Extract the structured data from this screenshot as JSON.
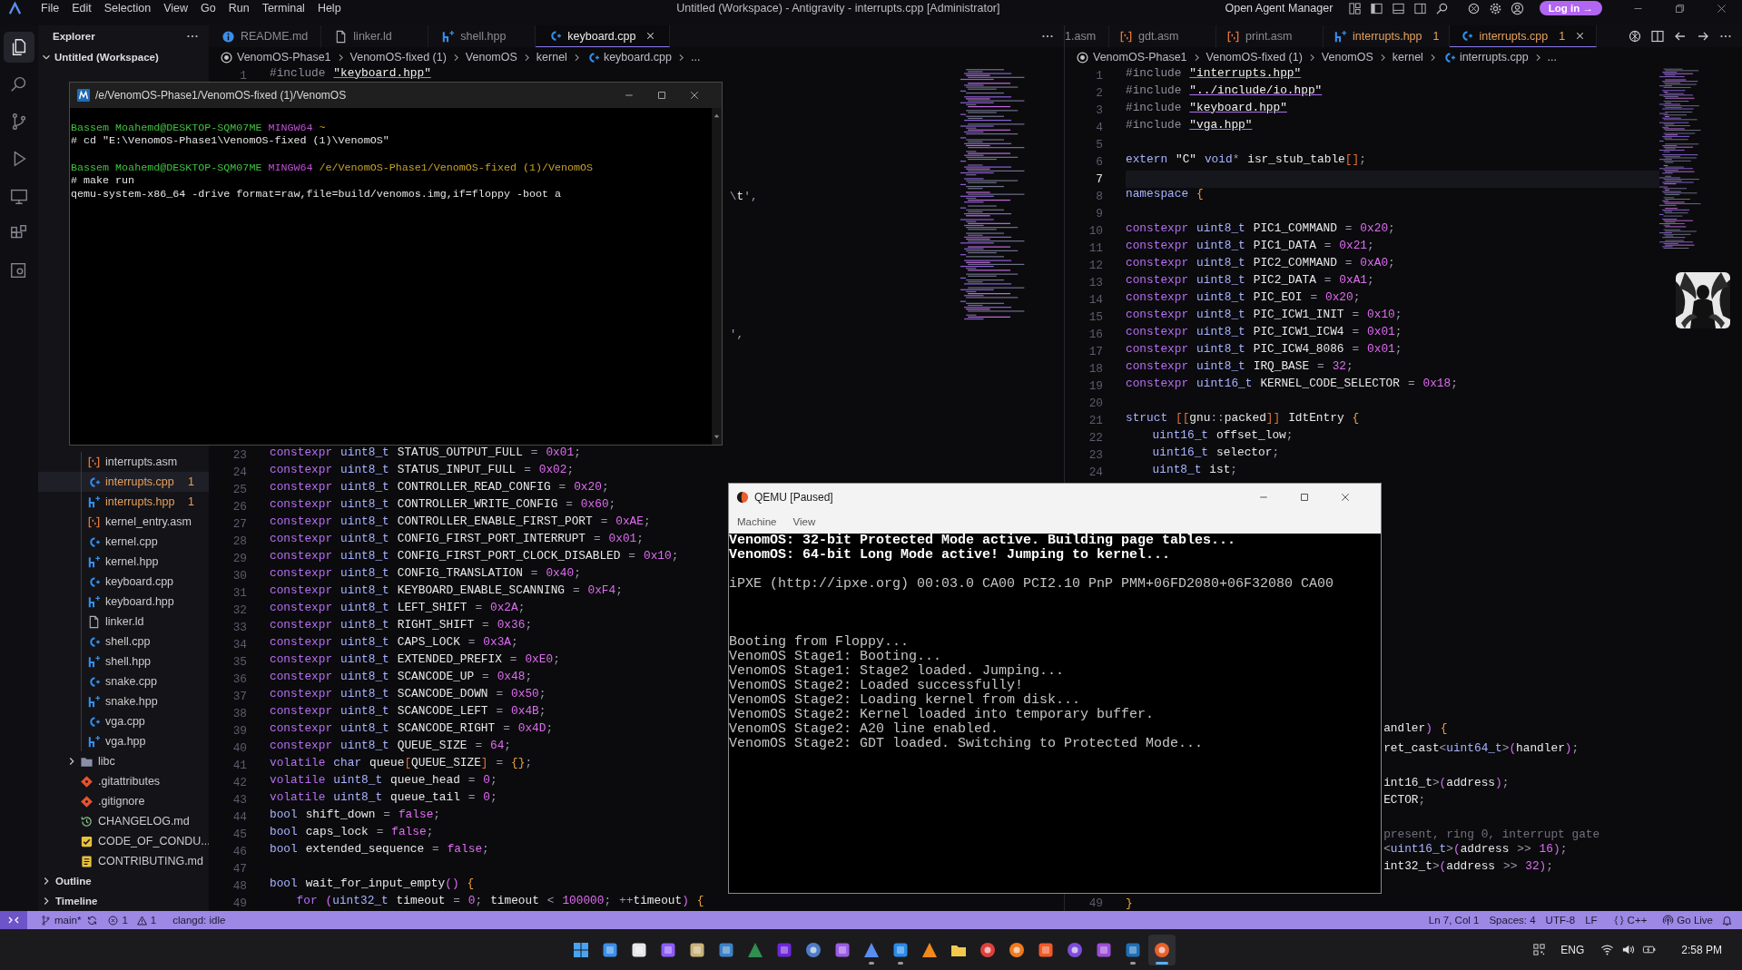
{
  "title_bar": {
    "menu": [
      "File",
      "Edit",
      "Selection",
      "View",
      "Go",
      "Run",
      "Terminal",
      "Help"
    ],
    "title": "Untitled (Workspace) - Antigravity - interrupts.cpp [Administrator]",
    "agent_manager": "Open Agent Manager",
    "login": "Log in →"
  },
  "activity_bar": [
    {
      "selected": true
    },
    {
      "selected": false
    },
    {
      "selected": false
    },
    {
      "selected": false
    },
    {
      "selected": false
    },
    {
      "selected": false
    },
    {
      "selected": false
    }
  ],
  "explorer": {
    "title": "Explorer",
    "workspace": {
      "name": "Untitled (Workspace)",
      "expanded": true
    },
    "tree": [
      {
        "kind": "covered_folder",
        "children": [
          {
            "name": "interrupts.asm",
            "kind": "asm",
            "selected": false
          },
          {
            "name": "interrupts.cpp",
            "kind": "cpp",
            "problems": "1",
            "selected": true
          },
          {
            "name": "interrupts.hpp",
            "kind": "hpp",
            "problems": "1",
            "selected": false
          },
          {
            "name": "kernel_entry.asm",
            "kind": "asm",
            "selected": false
          },
          {
            "name": "kernel.cpp",
            "kind": "cpp",
            "selected": false
          },
          {
            "name": "kernel.hpp",
            "kind": "hpp",
            "selected": false
          },
          {
            "name": "keyboard.cpp",
            "kind": "cpp",
            "selected": false
          },
          {
            "name": "keyboard.hpp",
            "kind": "hpp",
            "selected": false
          },
          {
            "name": "linker.ld",
            "kind": "file",
            "selected": false
          },
          {
            "name": "shell.cpp",
            "kind": "cpp",
            "selected": false
          },
          {
            "name": "shell.hpp",
            "kind": "hpp",
            "selected": false
          },
          {
            "name": "snake.cpp",
            "kind": "cpp",
            "selected": false
          },
          {
            "name": "snake.hpp",
            "kind": "hpp",
            "selected": false
          },
          {
            "name": "vga.cpp",
            "kind": "cpp",
            "selected": false
          },
          {
            "name": "vga.hpp",
            "kind": "hpp",
            "selected": false
          }
        ]
      },
      {
        "name": "libc",
        "kind": "folder",
        "expanded": false,
        "selected": false
      },
      {
        "name": ".gitattributes",
        "kind": "git",
        "selected": false
      },
      {
        "name": ".gitignore",
        "kind": "git",
        "selected": false
      },
      {
        "name": "CHANGELOG.md",
        "kind": "history",
        "selected": false
      },
      {
        "name": "CODE_OF_CONDU...",
        "kind": "check",
        "selected": false
      },
      {
        "name": "CONTRIBUTING.md",
        "kind": "note",
        "selected": false
      }
    ],
    "sections": [
      {
        "label": "Outline",
        "expanded": false
      },
      {
        "label": "Timeline",
        "expanded": false
      }
    ]
  },
  "left_editor": {
    "tabs": [
      {
        "label": "README.md",
        "kind": "info",
        "selected": false
      },
      {
        "label": "linker.ld",
        "kind": "file",
        "selected": false
      },
      {
        "label": "shell.hpp",
        "kind": "hpp",
        "selected": false
      },
      {
        "label": "keyboard.cpp",
        "kind": "cpp",
        "selected": true
      }
    ],
    "breadcrumbs": [
      {
        "text": "VenomOS-Phase1",
        "kind": "root"
      },
      {
        "text": "VenomOS-fixed (1)",
        "kind": "folder"
      },
      {
        "text": "VenomOS",
        "kind": "folder"
      },
      {
        "text": "kernel",
        "kind": "folder"
      },
      {
        "text": "keyboard.cpp",
        "kind": "file"
      },
      {
        "text": "...",
        "kind": "more"
      }
    ],
    "rows": [
      {
        "kind": "line",
        "n": "1",
        "text": "#include \"keyboard.hpp\""
      },
      {
        "kind": "covered"
      },
      {
        "kind": "covered"
      },
      {
        "kind": "covered"
      },
      {
        "kind": "covered"
      },
      {
        "kind": "covered"
      },
      {
        "kind": "covered"
      },
      {
        "kind": "tail",
        "text": "\\t',"
      },
      {
        "kind": "covered"
      },
      {
        "kind": "covered"
      },
      {
        "kind": "covered"
      },
      {
        "kind": "covered"
      },
      {
        "kind": "covered"
      },
      {
        "kind": "covered"
      },
      {
        "kind": "covered"
      },
      {
        "kind": "tail",
        "text": "',"
      },
      {
        "kind": "covered"
      },
      {
        "kind": "covered"
      },
      {
        "kind": "covered"
      },
      {
        "kind": "covered"
      },
      {
        "kind": "covered"
      },
      {
        "kind": "covered"
      },
      {
        "kind": "line",
        "n": "23",
        "text": "constexpr uint8_t STATUS_OUTPUT_FULL = 0x01;"
      },
      {
        "kind": "line",
        "n": "24",
        "text": "constexpr uint8_t STATUS_INPUT_FULL = 0x02;"
      },
      {
        "kind": "line",
        "n": "25",
        "text": "constexpr uint8_t CONTROLLER_READ_CONFIG = 0x20;"
      },
      {
        "kind": "line",
        "n": "26",
        "text": "constexpr uint8_t CONTROLLER_WRITE_CONFIG = 0x60;"
      },
      {
        "kind": "line",
        "n": "27",
        "text": "constexpr uint8_t CONTROLLER_ENABLE_FIRST_PORT = 0xAE;"
      },
      {
        "kind": "line",
        "n": "28",
        "text": "constexpr uint8_t CONFIG_FIRST_PORT_INTERRUPT = 0x01;"
      },
      {
        "kind": "line",
        "n": "29",
        "text": "constexpr uint8_t CONFIG_FIRST_PORT_CLOCK_DISABLED = 0x10;"
      },
      {
        "kind": "line",
        "n": "30",
        "text": "constexpr uint8_t CONFIG_TRANSLATION = 0x40;"
      },
      {
        "kind": "line",
        "n": "31",
        "text": "constexpr uint8_t KEYBOARD_ENABLE_SCANNING = 0xF4;"
      },
      {
        "kind": "line",
        "n": "32",
        "text": "constexpr uint8_t LEFT_SHIFT = 0x2A;"
      },
      {
        "kind": "line",
        "n": "33",
        "text": "constexpr uint8_t RIGHT_SHIFT = 0x36;"
      },
      {
        "kind": "line",
        "n": "34",
        "text": "constexpr uint8_t CAPS_LOCK = 0x3A;"
      },
      {
        "kind": "line",
        "n": "35",
        "text": "constexpr uint8_t EXTENDED_PREFIX = 0xE0;"
      },
      {
        "kind": "line",
        "n": "36",
        "text": "constexpr uint8_t SCANCODE_UP = 0x48;"
      },
      {
        "kind": "line",
        "n": "37",
        "text": "constexpr uint8_t SCANCODE_DOWN = 0x50;"
      },
      {
        "kind": "line",
        "n": "38",
        "text": "constexpr uint8_t SCANCODE_LEFT = 0x4B;"
      },
      {
        "kind": "line",
        "n": "39",
        "text": "constexpr uint8_t SCANCODE_RIGHT = 0x4D;"
      },
      {
        "kind": "line",
        "n": "40",
        "text": "constexpr uint8_t QUEUE_SIZE = 64;"
      },
      {
        "kind": "line",
        "n": "41",
        "text": "volatile char queue[QUEUE_SIZE] = {};"
      },
      {
        "kind": "line",
        "n": "42",
        "text": "volatile uint8_t queue_head = 0;"
      },
      {
        "kind": "line",
        "n": "43",
        "text": "volatile uint8_t queue_tail = 0;"
      },
      {
        "kind": "line",
        "n": "44",
        "text": "bool shift_down = false;"
      },
      {
        "kind": "line",
        "n": "45",
        "text": "bool caps_lock = false;"
      },
      {
        "kind": "line",
        "n": "46",
        "text": "bool extended_sequence = false;"
      },
      {
        "kind": "line",
        "n": "47"
      },
      {
        "kind": "line",
        "n": "48",
        "text": "bool wait_for_input_empty() {"
      },
      {
        "kind": "line",
        "n": "49",
        "text": "    for (uint32_t timeout = 0; timeout < 100000; ++timeout) {"
      }
    ]
  },
  "right_editor": {
    "tabs": [
      {
        "label": "1.asm",
        "kind": "clipped",
        "selected": false
      },
      {
        "label": "gdt.asm",
        "kind": "asm",
        "selected": false
      },
      {
        "label": "print.asm",
        "kind": "asm",
        "selected": false
      },
      {
        "label": "interrupts.hpp",
        "kind": "hpp",
        "problems": "1",
        "selected": false
      },
      {
        "label": "interrupts.cpp",
        "kind": "cpp",
        "problems": "1",
        "selected": true
      }
    ],
    "breadcrumbs": [
      {
        "text": "VenomOS-Phase1",
        "kind": "root"
      },
      {
        "text": "VenomOS-fixed (1)",
        "kind": "folder"
      },
      {
        "text": "VenomOS",
        "kind": "folder"
      },
      {
        "text": "kernel",
        "kind": "folder"
      },
      {
        "text": "interrupts.cpp",
        "kind": "file"
      },
      {
        "text": "...",
        "kind": "more"
      }
    ],
    "rows": [
      {
        "kind": "line",
        "n": "1",
        "text": "#include \"interrupts.hpp\"",
        "current": false
      },
      {
        "kind": "line",
        "n": "2",
        "text": "#include \"../include/io.hpp\"",
        "current": false
      },
      {
        "kind": "line",
        "n": "3",
        "text": "#include \"keyboard.hpp\"",
        "current": false
      },
      {
        "kind": "line",
        "n": "4",
        "text": "#include \"vga.hpp\"",
        "current": false
      },
      {
        "kind": "line",
        "n": "5",
        "current": false
      },
      {
        "kind": "line",
        "n": "6",
        "text": "extern \"C\" void* isr_stub_table[];",
        "current": false
      },
      {
        "kind": "line",
        "n": "7",
        "current": true
      },
      {
        "kind": "line",
        "n": "8",
        "text": "namespace {",
        "current": false
      },
      {
        "kind": "line",
        "n": "9",
        "current": false
      },
      {
        "kind": "line",
        "n": "10",
        "text": "constexpr uint8_t PIC1_COMMAND = 0x20;",
        "current": false
      },
      {
        "kind": "line",
        "n": "11",
        "text": "constexpr uint8_t PIC1_DATA = 0x21;",
        "current": false
      },
      {
        "kind": "line",
        "n": "12",
        "text": "constexpr uint8_t PIC2_COMMAND = 0xA0;",
        "current": false
      },
      {
        "kind": "line",
        "n": "13",
        "text": "constexpr uint8_t PIC2_DATA = 0xA1;",
        "current": false
      },
      {
        "kind": "line",
        "n": "14",
        "text": "constexpr uint8_t PIC_EOI = 0x20;",
        "current": false
      },
      {
        "kind": "line",
        "n": "15",
        "text": "constexpr uint8_t PIC_ICW1_INIT = 0x10;",
        "current": false
      },
      {
        "kind": "line",
        "n": "16",
        "text": "constexpr uint8_t PIC_ICW1_ICW4 = 0x01;",
        "current": false
      },
      {
        "kind": "line",
        "n": "17",
        "text": "constexpr uint8_t PIC_ICW4_8086 = 0x01;",
        "current": false
      },
      {
        "kind": "line",
        "n": "18",
        "text": "constexpr uint8_t IRQ_BASE = 32;",
        "current": false
      },
      {
        "kind": "line",
        "n": "19",
        "text": "constexpr uint16_t KERNEL_CODE_SELECTOR = 0x18;",
        "current": false
      },
      {
        "kind": "line",
        "n": "20",
        "current": false
      },
      {
        "kind": "line",
        "n": "21",
        "text": "struct [[gnu::packed]] IdtEntry {",
        "current": false
      },
      {
        "kind": "line",
        "n": "22",
        "text": "    uint16_t offset_low;",
        "current": false
      },
      {
        "kind": "line",
        "n": "23",
        "text": "    uint16_t selector;",
        "current": false
      },
      {
        "kind": "line",
        "n": "24",
        "text": "    uint8_t ist;",
        "current": false
      },
      {
        "kind": "covered"
      },
      {
        "kind": "covered"
      },
      {
        "kind": "covered"
      },
      {
        "kind": "covered"
      },
      {
        "kind": "covered"
      },
      {
        "kind": "covered"
      },
      {
        "kind": "covered"
      },
      {
        "kind": "covered"
      },
      {
        "kind": "covered"
      },
      {
        "kind": "covered"
      },
      {
        "kind": "covered"
      },
      {
        "kind": "covered"
      },
      {
        "kind": "covered"
      },
      {
        "kind": "covered"
      },
      {
        "kind": "tail",
        "text": "andler) {"
      },
      {
        "kind": "tail",
        "text": "ret_cast<uint64_t>(handler);"
      },
      {
        "kind": "covered"
      },
      {
        "kind": "tail",
        "text": "int16_t>(address);"
      },
      {
        "kind": "tail",
        "text": "ECTOR;"
      },
      {
        "kind": "covered"
      },
      {
        "kind": "comment_tail",
        "text": "present, ring 0, interrupt gate"
      },
      {
        "kind": "tail",
        "text": "<uint16_t>(address >> 16);"
      },
      {
        "kind": "tail",
        "text": "int32_t>(address >> 32);"
      },
      {
        "kind": "covered"
      },
      {
        "kind": "line",
        "n": "49",
        "text": "}",
        "current": false
      }
    ]
  },
  "terminal_window": {
    "title": "/e/VenomOS-Phase1/VenomOS-fixed (1)/VenomOS",
    "lines": [
      {
        "kind": "blank"
      },
      {
        "kind": "text",
        "segments": [
          {
            "kind": "user",
            "text": "Bassem Moahemd@DESKTOP-SQM07ME"
          },
          {
            "kind": "shell",
            "text": "MINGW64"
          },
          {
            "kind": "path",
            "text": "~"
          }
        ]
      },
      {
        "kind": "text",
        "segments": [
          {
            "kind": "plain",
            "text": "# cd \"E:\\VenomOS-Phase1\\VenomOS-fixed (1)\\VenomOS\""
          }
        ]
      },
      {
        "kind": "blank"
      },
      {
        "kind": "text",
        "segments": [
          {
            "kind": "user",
            "text": "Bassem Moahemd@DESKTOP-SQM07ME"
          },
          {
            "kind": "shell",
            "text": "MINGW64"
          },
          {
            "kind": "path",
            "text": "/e/VenomOS-Phase1/VenomOS-fixed (1)/VenomOS"
          }
        ]
      },
      {
        "kind": "text",
        "segments": [
          {
            "kind": "plain",
            "text": "# make run"
          }
        ]
      },
      {
        "kind": "text",
        "segments": [
          {
            "kind": "plain",
            "text": "qemu-system-x86_64 -drive format=raw,file=build/venomos.img,if=floppy -boot a"
          }
        ]
      }
    ]
  },
  "qemu_window": {
    "title": "QEMU [Paused]",
    "menu": [
      "Machine",
      "View"
    ],
    "console": [
      {
        "kind": "text",
        "text": "VenomOS: 32-bit Protected Mode active. Building page tables...",
        "bright": true
      },
      {
        "kind": "text",
        "text": "VenomOS: 64-bit Long Mode active! Jumping to kernel...",
        "bright": true
      },
      {
        "kind": "blank"
      },
      {
        "kind": "text",
        "text": "iPXE (http://ipxe.org) 00:03.0 CA00 PCI2.10 PnP PMM+06FD2080+06F32080 CA00",
        "bright": false
      },
      {
        "kind": "blank"
      },
      {
        "kind": "blank"
      },
      {
        "kind": "blank"
      },
      {
        "kind": "text",
        "text": "Booting from Floppy...",
        "bright": false
      },
      {
        "kind": "text",
        "text": "VenomOS Stage1: Booting...",
        "bright": false
      },
      {
        "kind": "text",
        "text": "VenomOS Stage1: Stage2 loaded. Jumping...",
        "bright": false
      },
      {
        "kind": "text",
        "text": "VenomOS Stage2: Loaded successfully!",
        "bright": false
      },
      {
        "kind": "text",
        "text": "VenomOS Stage2: Loading kernel from disk...",
        "bright": false
      },
      {
        "kind": "text",
        "text": "VenomOS Stage2: Kernel loaded into temporary buffer.",
        "bright": false
      },
      {
        "kind": "text",
        "text": "VenomOS Stage2: A20 line enabled.",
        "bright": false
      },
      {
        "kind": "text",
        "text": "VenomOS Stage2: GDT loaded. Switching to Protected Mode...",
        "bright": false
      }
    ]
  },
  "status_bar": {
    "branch": "main*",
    "errors": "1",
    "warnings": "1",
    "server": "clangd: idle",
    "items": [
      {
        "kind": "plain",
        "text": "Ln 7, Col 1"
      },
      {
        "kind": "plain",
        "text": "Spaces: 4"
      },
      {
        "kind": "plain",
        "text": "UTF-8"
      },
      {
        "kind": "plain",
        "text": "LF"
      },
      {
        "kind": "language",
        "text": "C++"
      },
      {
        "kind": "live",
        "text": "Go Live"
      }
    ]
  },
  "taskbar": {
    "apps": [
      {
        "running": false,
        "selected": false
      },
      {
        "running": false,
        "selected": false
      },
      {
        "running": false,
        "selected": false
      },
      {
        "running": false,
        "selected": false
      },
      {
        "running": false,
        "selected": false
      },
      {
        "running": false,
        "selected": false
      },
      {
        "running": false,
        "selected": false
      },
      {
        "running": false,
        "selected": false
      },
      {
        "running": false,
        "selected": false
      },
      {
        "running": false,
        "selected": false
      },
      {
        "running": true,
        "selected": false
      },
      {
        "running": true,
        "selected": false
      },
      {
        "running": false,
        "selected": false
      },
      {
        "running": false,
        "selected": false
      },
      {
        "running": false,
        "selected": false
      },
      {
        "running": false,
        "selected": false
      },
      {
        "running": false,
        "selected": false
      },
      {
        "running": false,
        "selected": false
      },
      {
        "running": false,
        "selected": false
      },
      {
        "running": true,
        "selected": false
      },
      {
        "running": true,
        "selected": true
      }
    ],
    "language": "ENG",
    "time": "2:58 PM"
  }
}
